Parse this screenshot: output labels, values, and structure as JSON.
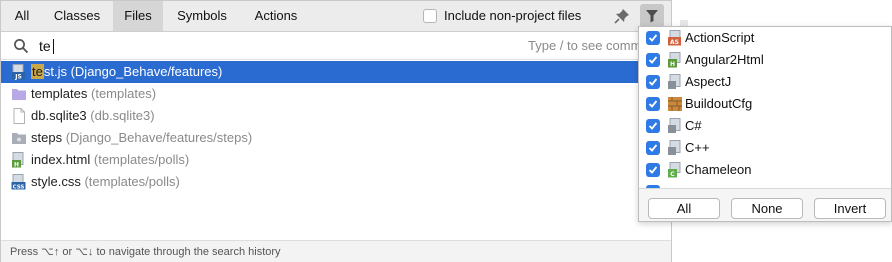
{
  "tabs": [
    {
      "label": "All"
    },
    {
      "label": "Classes"
    },
    {
      "label": "Files"
    },
    {
      "label": "Symbols"
    },
    {
      "label": "Actions"
    }
  ],
  "selected_tab": "Files",
  "include_checkbox": {
    "label": "Include non-project files",
    "checked": false
  },
  "search": {
    "value": "te",
    "hint": "Type / to see comma"
  },
  "results": [
    {
      "name_highlight": "te",
      "name_rest": "st.js",
      "path": "(Django_Behave/features)",
      "icon": "js-file-icon",
      "selected": true
    },
    {
      "name_highlight": "",
      "name_rest": "templates",
      "path": "(templates)",
      "icon": "folder-icon",
      "selected": false
    },
    {
      "name_highlight": "",
      "name_rest": "db.sqlite3",
      "path": "(db.sqlite3)",
      "icon": "text-file-icon",
      "selected": false
    },
    {
      "name_highlight": "",
      "name_rest": "steps",
      "path": "(Django_Behave/features/steps)",
      "icon": "package-folder-icon",
      "selected": false
    },
    {
      "name_highlight": "",
      "name_rest": "index.html",
      "path": "(templates/polls)",
      "icon": "html-file-icon",
      "selected": false
    },
    {
      "name_highlight": "",
      "name_rest": "style.css",
      "path": "(templates/polls)",
      "icon": "css-file-icon",
      "selected": false
    }
  ],
  "status": "Press ⌥↑ or ⌥↓ to navigate through the search history",
  "filter_popup": {
    "items": [
      {
        "label": "ActionScript",
        "checked": true,
        "icon": "actionscript-icon"
      },
      {
        "label": "Angular2Html",
        "checked": true,
        "icon": "angular-html-icon"
      },
      {
        "label": "AspectJ",
        "checked": true,
        "icon": "aspectj-icon"
      },
      {
        "label": "BuildoutCfg",
        "checked": true,
        "icon": "buildout-cfg-icon"
      },
      {
        "label": "C#",
        "checked": true,
        "icon": "csharp-icon"
      },
      {
        "label": "C++",
        "checked": true,
        "icon": "cpp-icon"
      },
      {
        "label": "Chameleon",
        "checked": true,
        "icon": "chameleon-icon"
      }
    ],
    "buttons": {
      "all": "All",
      "none": "None",
      "invert": "Invert"
    }
  },
  "colors": {
    "selection": "#2a6bd1",
    "checkbox": "#2f7ae5",
    "highlight": "#c9a84a"
  }
}
